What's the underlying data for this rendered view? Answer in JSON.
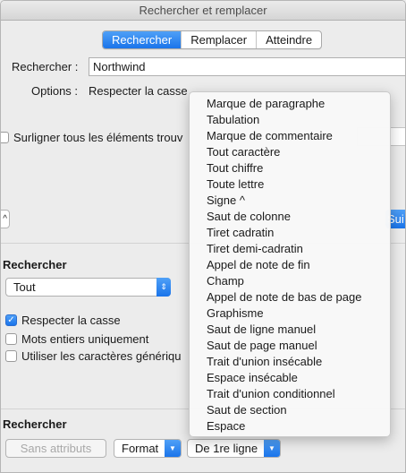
{
  "window": {
    "title": "Rechercher et remplacer"
  },
  "tabs": [
    {
      "label": "Rechercher",
      "active": true
    },
    {
      "label": "Remplacer",
      "active": false
    },
    {
      "label": "Atteindre",
      "active": false
    }
  ],
  "search": {
    "label": "Rechercher :",
    "value": "Northwind",
    "options_label": "Options :",
    "options_value": "Respecter la casse"
  },
  "highlight_label": "Surligner tous les éléments trouv",
  "up_arrow": "^",
  "partial_button_label": "Sui",
  "search_section": {
    "title": "Rechercher",
    "scope_value": "Tout",
    "checkboxes": [
      {
        "label": "Respecter la casse",
        "checked": true
      },
      {
        "label": "Mots entiers uniquement",
        "checked": false
      },
      {
        "label": "Utiliser les caractères génériqu",
        "checked": false
      }
    ]
  },
  "bottom_section": {
    "title": "Rechercher",
    "no_attributes_label": "Sans attributs",
    "format_label": "Format",
    "special_label": "De 1re ligne"
  },
  "special_menu": {
    "items": [
      "Marque de paragraphe",
      "Tabulation",
      "Marque de commentaire",
      "Tout caractère",
      "Tout chiffre",
      "Toute lettre",
      "Signe ^",
      "Saut de colonne",
      "Tiret cadratin",
      "Tiret demi-cadratin",
      "Appel de note de fin",
      "Champ",
      "Appel de note de bas de page",
      "Graphisme",
      "Saut de ligne manuel",
      "Saut de page manuel",
      "Trait d'union insécable",
      "Espace insécable",
      "Trait d'union conditionnel",
      "Saut de section",
      "Espace"
    ]
  },
  "colors": {
    "accent": "#1a74ea",
    "window_bg": "#ececec"
  }
}
